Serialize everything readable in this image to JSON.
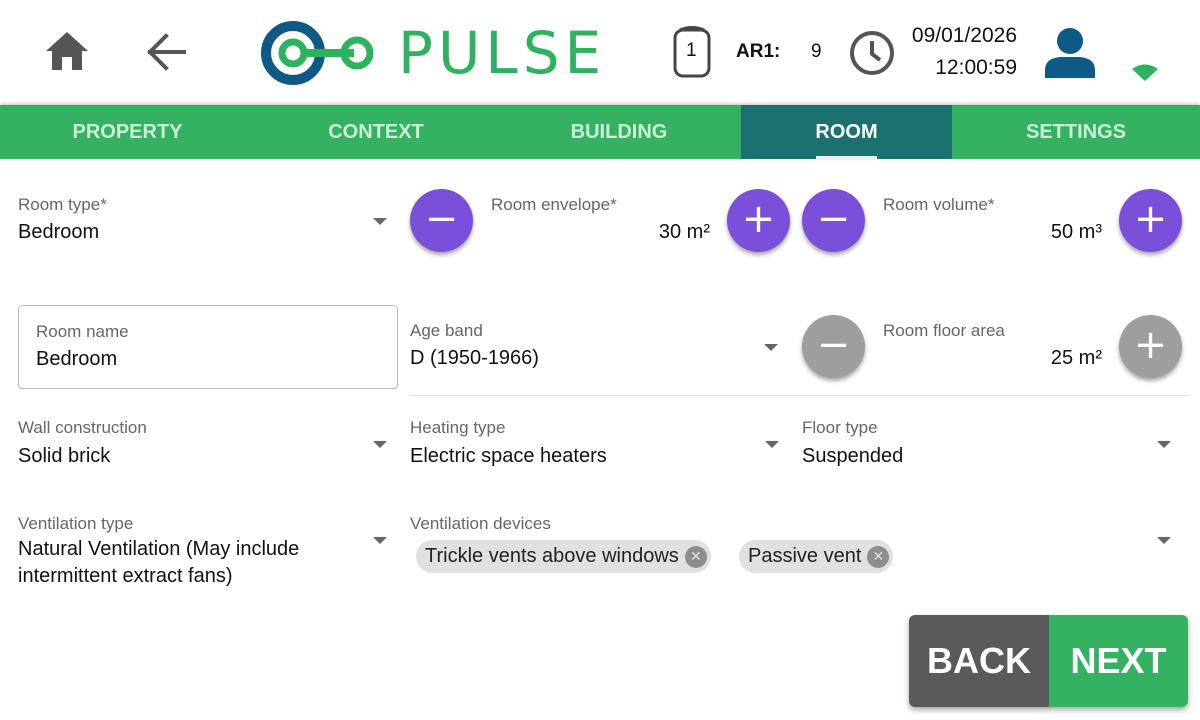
{
  "app": {
    "name": "PULSE"
  },
  "header": {
    "ar_label": "AR1:",
    "ar_value": "9",
    "device_count": "1",
    "date": "09/01/2026",
    "time": "12:00:59",
    "icons": [
      "home-icon",
      "back-arrow-icon",
      "device-icon",
      "clock-icon",
      "user-icon",
      "wifi-icon"
    ]
  },
  "tabs": [
    {
      "label": "PROPERTY"
    },
    {
      "label": "CONTEXT"
    },
    {
      "label": "BUILDING"
    },
    {
      "label": "ROOM",
      "active": true
    },
    {
      "label": "SETTINGS"
    }
  ],
  "form": {
    "room_type": {
      "label": "Room type*",
      "value": "Bedroom"
    },
    "room_envelope": {
      "label": "Room envelope*",
      "value": "30 m²"
    },
    "room_volume": {
      "label": "Room volume*",
      "value": "50 m³"
    },
    "room_name": {
      "label": "Room name",
      "value": "Bedroom"
    },
    "age_band": {
      "label": "Age band",
      "value": "D (1950-1966)"
    },
    "room_floor_area": {
      "label": "Room floor area",
      "value": "25 m²"
    },
    "wall_construction": {
      "label": "Wall construction",
      "value": "Solid brick"
    },
    "heating_type": {
      "label": "Heating type",
      "value": "Electric space heaters"
    },
    "floor_type": {
      "label": "Floor type",
      "value": "Suspended"
    },
    "ventilation_type": {
      "label": "Ventilation type",
      "value": "Natural Ventilation (May include intermittent extract fans)"
    },
    "ventilation_devices": {
      "label": "Ventilation devices",
      "chips": [
        "Trickle vents above windows",
        "Passive vent"
      ]
    }
  },
  "footer": {
    "back_label": "BACK",
    "next_label": "NEXT"
  },
  "colors": {
    "brand_green": "#34b262",
    "logo_blue": "#0e5a84",
    "active_tab": "#1a7170",
    "stepper_purple": "#7a4fd9",
    "stepper_disabled": "#9e9e9e",
    "back_button": "#5a5a5a",
    "user_icon": "#0e5a84"
  }
}
